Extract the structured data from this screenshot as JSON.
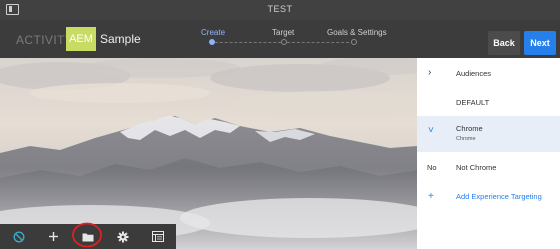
{
  "window": {
    "title": "TEST"
  },
  "header": {
    "activity_label": "ACTIVITY:",
    "badge": "AEM",
    "name": "Sample",
    "steps": [
      {
        "label": "Create",
        "active": true
      },
      {
        "label": "Target",
        "active": false
      },
      {
        "label": "Goals & Settings",
        "active": false
      }
    ],
    "back_label": "Back",
    "next_label": "Next"
  },
  "toolbar": {
    "tools": [
      "disable-icon",
      "add-icon",
      "folder-icon",
      "gear-icon",
      "list-icon"
    ],
    "highlighted_tool": "folder-icon"
  },
  "panel": {
    "audiences_label": "Audiences",
    "default_label": "DEFAULT",
    "chrome_title": "Chrome",
    "chrome_subtitle": "Chrome",
    "no_label": "No",
    "not_chrome_label": "Not Chrome",
    "add_targeting_label": "Add Experience Targeting"
  },
  "colors": {
    "accent": "#2680eb",
    "active_step": "#8fb3ff",
    "badge": "#c8dc63",
    "highlight_circle": "#e02020"
  }
}
